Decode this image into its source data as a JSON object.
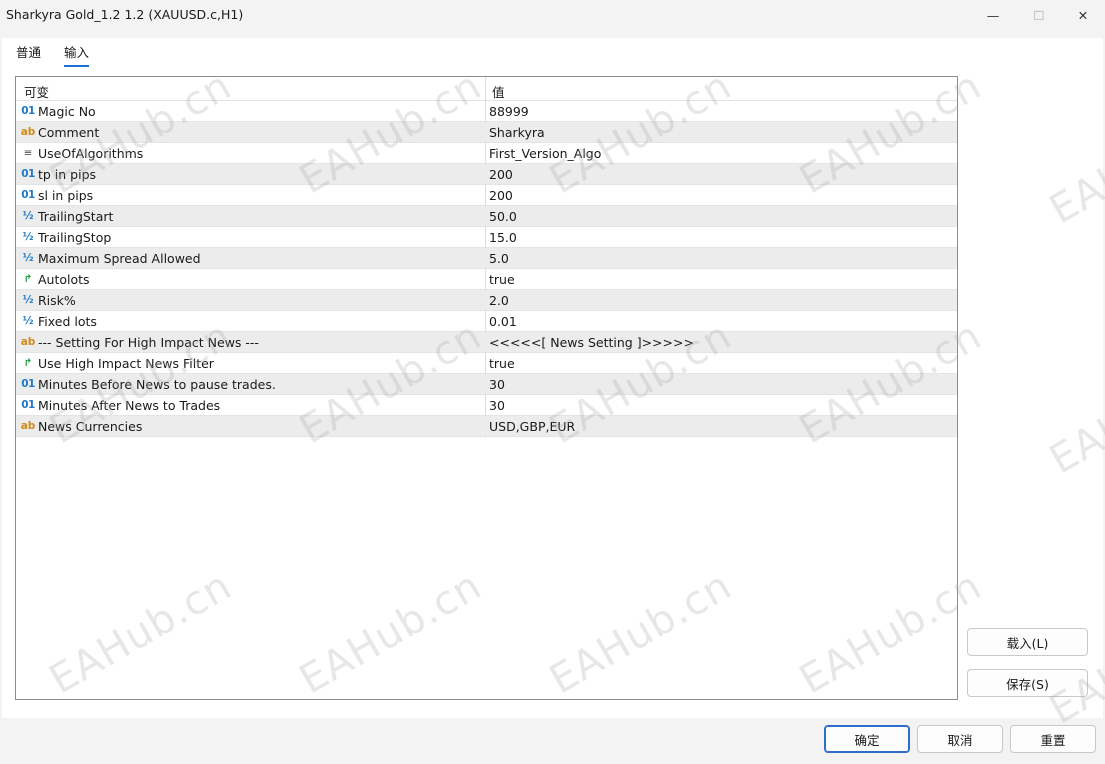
{
  "window": {
    "title": "Sharkyra Gold_1.2 1.2 (XAUUSD.c,H1)",
    "minimize_glyph": "—",
    "maximize_glyph": "☐",
    "close_glyph": "✕"
  },
  "tabs": [
    {
      "label": "普通",
      "active": false
    },
    {
      "label": "输入",
      "active": true
    }
  ],
  "table": {
    "headers": {
      "variable": "可变",
      "value": "值"
    },
    "rows": [
      {
        "icon": "01",
        "type": "int",
        "name": "Magic No",
        "value": "88999"
      },
      {
        "icon": "ab",
        "type": "string",
        "name": "Comment",
        "value": "Sharkyra"
      },
      {
        "icon": "≡",
        "type": "enum",
        "name": "UseOfAlgorithms",
        "value": "First_Version_Algo"
      },
      {
        "icon": "01",
        "type": "int",
        "name": "tp in pips",
        "value": "200"
      },
      {
        "icon": "01",
        "type": "int",
        "name": "sl in pips",
        "value": "200"
      },
      {
        "icon": "½",
        "type": "double",
        "name": "TrailingStart",
        "value": "50.0"
      },
      {
        "icon": "½",
        "type": "double",
        "name": "TrailingStop",
        "value": "15.0"
      },
      {
        "icon": "½",
        "type": "double",
        "name": "Maximum Spread Allowed",
        "value": "5.0"
      },
      {
        "icon": "↱",
        "type": "bool",
        "name": "Autolots",
        "value": "true"
      },
      {
        "icon": "½",
        "type": "double",
        "name": "Risk%",
        "value": "2.0"
      },
      {
        "icon": "½",
        "type": "double",
        "name": "Fixed lots",
        "value": "0.01"
      },
      {
        "icon": "ab",
        "type": "string",
        "name": "--- Setting For High Impact News ---",
        "value": " <<<<<[  News Setting  ]>>>>>"
      },
      {
        "icon": "↱",
        "type": "bool",
        "name": "Use High Impact News Filter",
        "value": "true"
      },
      {
        "icon": "01",
        "type": "int",
        "name": "Minutes Before News to pause trades.",
        "value": "30"
      },
      {
        "icon": "01",
        "type": "int",
        "name": "Minutes After News to Trades",
        "value": "30"
      },
      {
        "icon": "ab",
        "type": "string",
        "name": "News Currencies",
        "value": "USD,GBP,EUR"
      }
    ]
  },
  "side_buttons": {
    "load": "载入(L)",
    "save": "保存(S)"
  },
  "footer_buttons": {
    "ok": "确定",
    "cancel": "取消",
    "reset": "重置"
  },
  "watermark": "EAHub.cn",
  "colors": {
    "accent": "#2c6ec9",
    "int_icon": "#1f78c8",
    "string_icon": "#d08a1a",
    "bool_icon": "#2aa048"
  }
}
